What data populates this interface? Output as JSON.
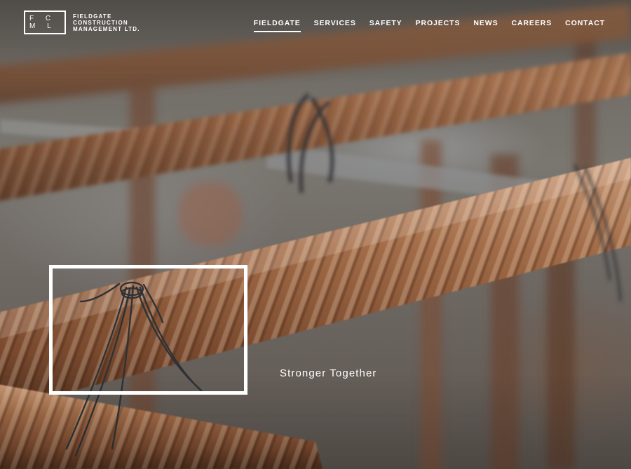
{
  "brand": {
    "monogram": "F C M L",
    "name_lines": [
      "FIELDGATE",
      "CONSTRUCTION",
      "MANAGEMENT LTD."
    ]
  },
  "nav": {
    "items": [
      {
        "label": "FIELDGATE",
        "active": true
      },
      {
        "label": "SERVICES"
      },
      {
        "label": "SAFETY"
      },
      {
        "label": "PROJECTS"
      },
      {
        "label": "NEWS"
      },
      {
        "label": "CAREERS"
      },
      {
        "label": "CONTACT"
      }
    ]
  },
  "hero": {
    "tagline": "Stronger Together",
    "image_subject": "rusted rebar tied with wire"
  },
  "colors": {
    "text": "#ffffff",
    "rebar": "#9a6a4a",
    "wire": "#2e3236"
  }
}
